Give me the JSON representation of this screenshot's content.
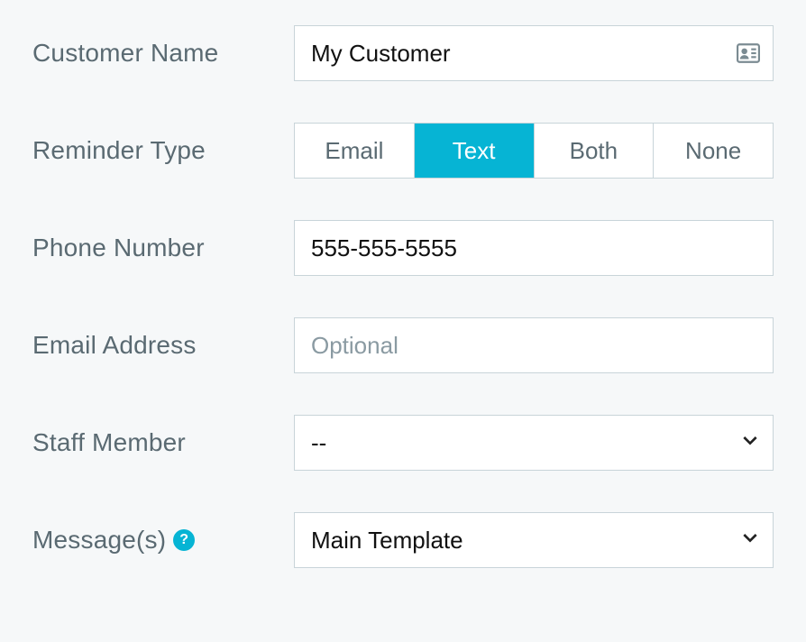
{
  "fields": {
    "customer_name": {
      "label": "Customer Name",
      "value": "My Customer"
    },
    "reminder_type": {
      "label": "Reminder Type",
      "options": [
        "Email",
        "Text",
        "Both",
        "None"
      ],
      "selected": "Text"
    },
    "phone_number": {
      "label": "Phone Number",
      "value": "555-555-5555"
    },
    "email_address": {
      "label": "Email Address",
      "value": "",
      "placeholder": "Optional"
    },
    "staff_member": {
      "label": "Staff Member",
      "selected": "--"
    },
    "messages": {
      "label": "Message(s)",
      "selected": "Main Template"
    }
  },
  "icons": {
    "help": "?"
  }
}
